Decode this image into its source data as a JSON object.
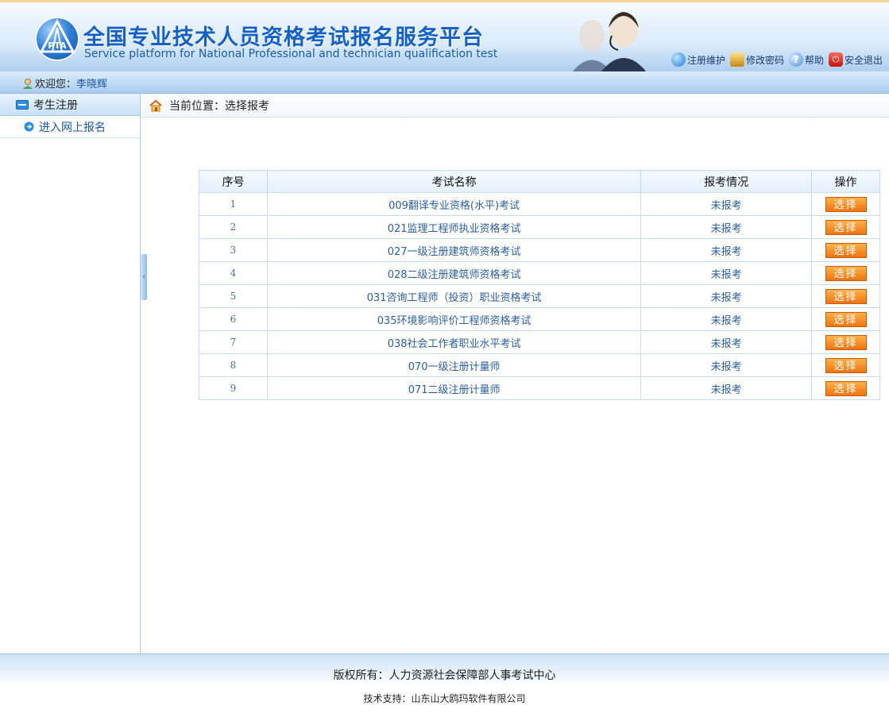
{
  "header": {
    "title_cn": "全国专业技术人员资格考试报名服务平台",
    "title_en": "Service platform for National Professional and technician qualification test",
    "logo_text": "PTA",
    "links": [
      {
        "label": "注册维护",
        "icon": "globe-icon"
      },
      {
        "label": "修改密码",
        "icon": "lock-icon"
      },
      {
        "label": "帮助",
        "icon": "help-icon"
      },
      {
        "label": "安全退出",
        "icon": "power-icon"
      }
    ]
  },
  "welcome": {
    "label": "欢迎您：",
    "user": "李晓辉"
  },
  "sidebar": {
    "heading": "考生注册",
    "items": [
      {
        "label": "进入网上报名"
      }
    ]
  },
  "breadcrumb": {
    "label": "当前位置：选择报考"
  },
  "table": {
    "headers": [
      "序号",
      "考试名称",
      "报考情况",
      "操作"
    ],
    "rows": [
      {
        "no": "1",
        "name": "009翻译专业资格(水平)考试",
        "status": "未报考",
        "action": "选择"
      },
      {
        "no": "2",
        "name": "021监理工程师执业资格考试",
        "status": "未报考",
        "action": "选择"
      },
      {
        "no": "3",
        "name": "027一级注册建筑师资格考试",
        "status": "未报考",
        "action": "选择"
      },
      {
        "no": "4",
        "name": "028二级注册建筑师资格考试",
        "status": "未报考",
        "action": "选择"
      },
      {
        "no": "5",
        "name": "031咨询工程师（投资）职业资格考试",
        "status": "未报考",
        "action": "选择"
      },
      {
        "no": "6",
        "name": "035环境影响评价工程师资格考试",
        "status": "未报考",
        "action": "选择"
      },
      {
        "no": "7",
        "name": "038社会工作者职业水平考试",
        "status": "未报考",
        "action": "选择"
      },
      {
        "no": "8",
        "name": "070一级注册计量师",
        "status": "未报考",
        "action": "选择"
      },
      {
        "no": "9",
        "name": "071二级注册计量师",
        "status": "未报考",
        "action": "选择"
      }
    ]
  },
  "footer": {
    "copyright": "版权所有：人力资源社会保障部人事考试中心",
    "support": "技术支持：山东山大鸥玛软件有限公司"
  },
  "colors": {
    "brand_blue": "#1560c5",
    "button_orange": "#f07410",
    "border_blue": "#c4daee"
  }
}
